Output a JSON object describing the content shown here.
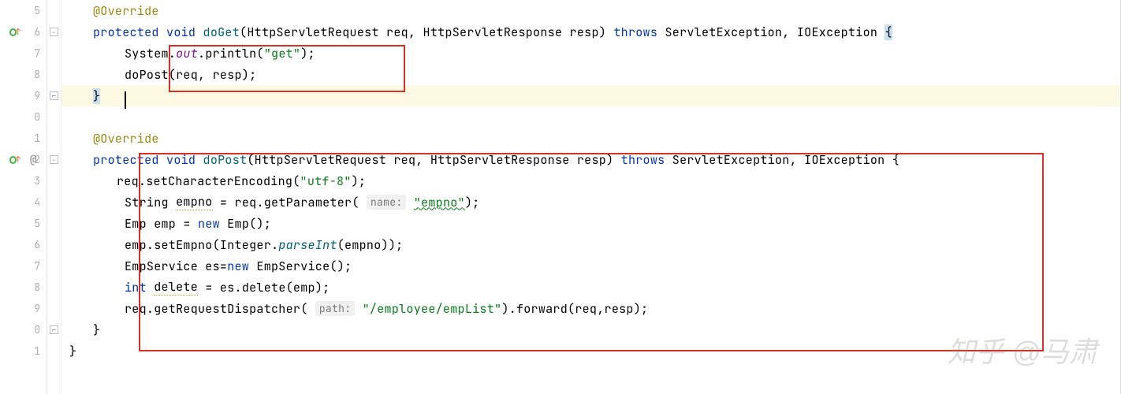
{
  "lines": {
    "l5_annotation": "@Override",
    "l6_protected": "protected",
    "l6_void": "void",
    "l6_method": "doGet",
    "l6_sig_open": "(HttpServletRequest req, HttpServletResponse resp) ",
    "l6_throws": "throws",
    "l6_exceptions": " ServletException, IOException ",
    "l6_brace": "{",
    "l7_system": "System.",
    "l7_out": "out",
    "l7_println": ".println(",
    "l7_str": "\"get\"",
    "l7_end": ");",
    "l8": "doPost(req, resp);",
    "l9_brace": "}",
    "l11_annotation": "@Override",
    "l12_protected": "protected",
    "l12_void": "void",
    "l12_method": "doPost",
    "l12_sig_open": "(HttpServletRequest req, HttpServletResponse resp) ",
    "l12_throws": "throws",
    "l12_exceptions": " ServletException, IOException {",
    "l13_pre": "req.setCharacterEncoding(",
    "l13_str": "\"utf-8\"",
    "l13_end": ");",
    "l14_pre": "String ",
    "l14_var": "empno",
    "l14_mid": " = req.getParameter( ",
    "l14_hint": "name:",
    "l14_sp": " ",
    "l14_str": "\"empno\"",
    "l14_end": ");",
    "l15_pre": "Emp emp = ",
    "l15_new": "new",
    "l15_end": " Emp();",
    "l16_pre": "emp.setEmpno(Integer.",
    "l16_parseInt": "parseInt",
    "l16_end": "(empno));",
    "l17_pre": "EmpService es=",
    "l17_new": "new",
    "l17_end": " EmpService();",
    "l18_int": "int",
    "l18_sp": " ",
    "l18_var": "delete",
    "l18_end": " = es.delete(emp);",
    "l19_pre": "req.getRequestDispatcher( ",
    "l19_hint": "path:",
    "l19_sp": " ",
    "l19_str": "\"/employee/empList\"",
    "l19_end": ").forward(req,resp);",
    "l20": "}",
    "l21": "}"
  },
  "gutter": {
    "line_numbers": [
      "5",
      "6",
      "7",
      "8",
      "9",
      "0",
      "1",
      "2",
      "3",
      "4",
      "5",
      "6",
      "7",
      "8",
      "9",
      "0",
      "1"
    ]
  },
  "watermark": "知乎 @马肃"
}
